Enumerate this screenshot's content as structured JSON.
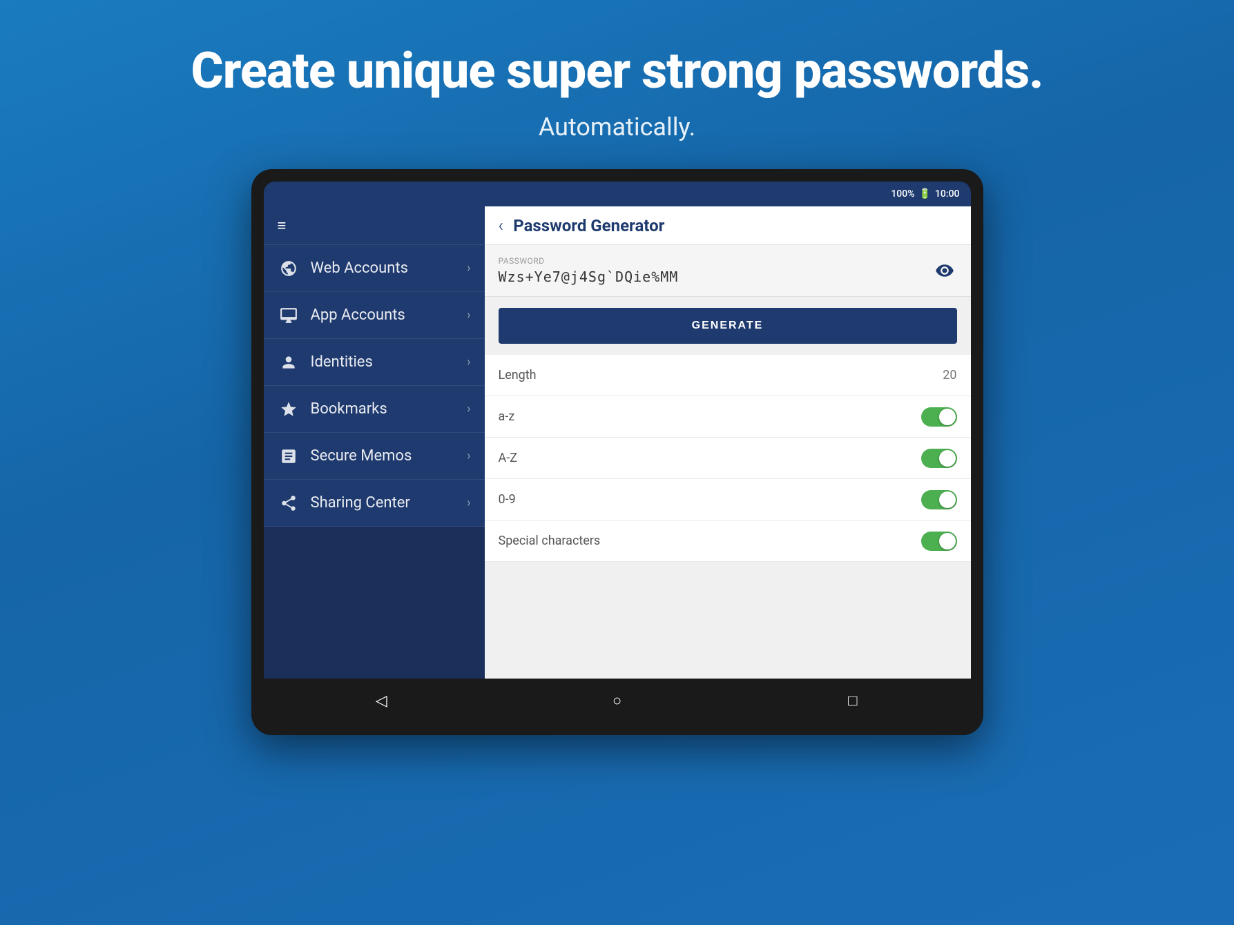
{
  "hero": {
    "title": "Create unique super strong passwords.",
    "subtitle": "Automatically."
  },
  "status_bar": {
    "battery": "100%",
    "time": "10:00"
  },
  "sidebar": {
    "items": [
      {
        "id": "web-accounts",
        "label": "Web Accounts",
        "icon": "globe"
      },
      {
        "id": "app-accounts",
        "label": "App Accounts",
        "icon": "monitor"
      },
      {
        "id": "identities",
        "label": "Identities",
        "icon": "person"
      },
      {
        "id": "bookmarks",
        "label": "Bookmarks",
        "icon": "star"
      },
      {
        "id": "secure-memos",
        "label": "Secure Memos",
        "icon": "memo"
      },
      {
        "id": "sharing-center",
        "label": "Sharing Center",
        "icon": "share"
      }
    ]
  },
  "main": {
    "header": {
      "title": "Password Generator",
      "back_label": "‹"
    },
    "password": {
      "label": "PASSWORD",
      "value": "Wzs+Ye7@j4Sg`DQie%MM"
    },
    "generate_button": "GENERATE",
    "options": [
      {
        "id": "length",
        "label": "Length",
        "value": "20",
        "type": "value"
      },
      {
        "id": "lowercase",
        "label": "a-z",
        "value": true,
        "type": "toggle"
      },
      {
        "id": "uppercase",
        "label": "A-Z",
        "value": true,
        "type": "toggle"
      },
      {
        "id": "digits",
        "label": "0-9",
        "value": true,
        "type": "toggle"
      },
      {
        "id": "special",
        "label": "Special characters",
        "value": true,
        "type": "toggle"
      }
    ]
  },
  "bottom_nav": {
    "back": "◁",
    "home": "○",
    "recent": "□"
  }
}
